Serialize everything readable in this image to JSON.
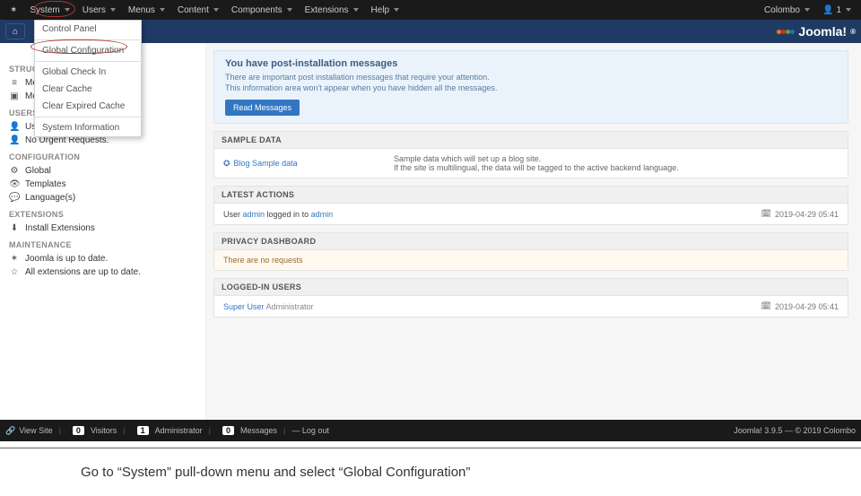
{
  "topmenu": {
    "items": [
      "System",
      "Users",
      "Menus",
      "Content",
      "Components",
      "Extensions",
      "Help"
    ],
    "right": {
      "user": "Colombo",
      "usercount": "1"
    }
  },
  "dropdown": {
    "items": [
      "Control Panel",
      "---",
      "Global Configuration",
      "---",
      "Global Check In",
      "Clear Cache",
      "Clear Expired Cache",
      "---",
      "System Information"
    ]
  },
  "brand": "Joomla!",
  "sidebar": {
    "groups": [
      {
        "title": "STRUCTURE",
        "items": [
          {
            "ico": "≡",
            "label": "Menu(s)"
          },
          {
            "ico": "▣",
            "label": "Modules"
          }
        ]
      },
      {
        "title": "USERS",
        "items": [
          {
            "ico": "👤",
            "label": "Users"
          },
          {
            "ico": "👤",
            "label": "No Urgent Requests."
          }
        ]
      },
      {
        "title": "CONFIGURATION",
        "items": [
          {
            "ico": "⚙",
            "label": "Global"
          },
          {
            "ico": "👁",
            "label": "Templates"
          },
          {
            "ico": "💬",
            "label": "Language(s)"
          }
        ]
      },
      {
        "title": "EXTENSIONS",
        "items": [
          {
            "ico": "⬇",
            "label": "Install Extensions"
          }
        ]
      },
      {
        "title": "MAINTENANCE",
        "items": [
          {
            "ico": "✶",
            "label": "Joomla is up to date."
          },
          {
            "ico": "☆",
            "label": "All extensions are up to date."
          }
        ]
      }
    ]
  },
  "info": {
    "title": "You have post-installation messages",
    "l1": "There are important post installation messages that require your attention.",
    "l2": "This information area won't appear when you have hidden all the messages.",
    "btn": "Read Messages"
  },
  "panels": {
    "sample": {
      "hdr": "SAMPLE DATA",
      "name": "Blog Sample data",
      "d1": "Sample data which will set up a blog site.",
      "d2": "If the site is multilingual, the data will be tagged to the active backend language."
    },
    "actions": {
      "hdr": "LATEST ACTIONS",
      "pre": "User ",
      "user": "admin",
      "mid": " logged in to ",
      "to": "admin",
      "date": "2019-04-29 05:41"
    },
    "privacy": {
      "hdr": "PRIVACY DASHBOARD",
      "txt": "There are no requests"
    },
    "logged": {
      "hdr": "LOGGED-IN USERS",
      "user": "Super User",
      "role": " Administrator",
      "date": "2019-04-29 05:41"
    }
  },
  "footer": {
    "view": "View Site",
    "visitors": "Visitors",
    "admin": "Administrator",
    "msg": "Messages",
    "logout": "Log out",
    "v": "0",
    "a": "1",
    "m": "0",
    "right": "Joomla! 3.9.5 — © 2019 Colombo"
  },
  "caption": "Go to “System” pull-down menu and select “Global Configuration”"
}
